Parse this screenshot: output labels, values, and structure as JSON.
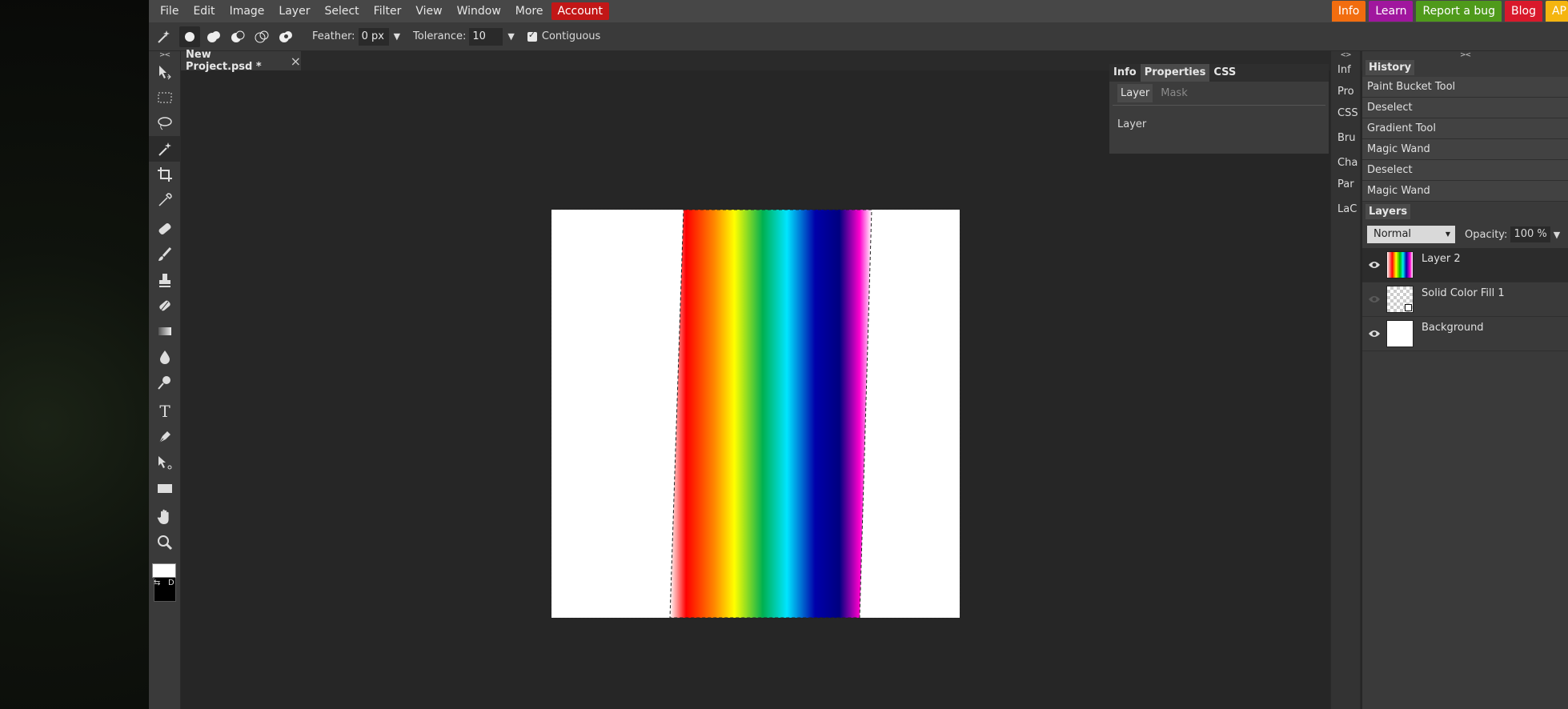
{
  "menu": {
    "items": [
      "File",
      "Edit",
      "Image",
      "Layer",
      "Select",
      "Filter",
      "View",
      "Window",
      "More"
    ],
    "account": "Account"
  },
  "top_links": [
    {
      "label": "Info",
      "color": "#f26d0f"
    },
    {
      "label": "Learn",
      "color": "#a0169e"
    },
    {
      "label": "Report a bug",
      "color": "#4f9a1b"
    },
    {
      "label": "Blog",
      "color": "#d9192b"
    },
    {
      "label": "AP",
      "color": "#f5b50f"
    }
  ],
  "options": {
    "feather_label": "Feather:",
    "feather_value": "0  px",
    "tolerance_label": "Tolerance:",
    "tolerance_value": "10",
    "contiguous_label": "Contiguous"
  },
  "toolbar": {
    "collapse": "><",
    "tools": [
      "move-icon",
      "marquee-icon",
      "lasso-icon",
      "magic-wand-icon",
      "crop-icon",
      "eyedropper-icon",
      "healing-icon",
      "brush-icon",
      "stamp-icon",
      "eraser-icon",
      "gradient-icon",
      "blur-icon",
      "dodge-icon",
      "type-icon",
      "pen-icon",
      "path-select-icon",
      "shape-icon",
      "hand-icon",
      "zoom-icon"
    ],
    "type_glyph": "T"
  },
  "document": {
    "tab_title": "New Project.psd *",
    "close": "×"
  },
  "properties_panel": {
    "tabs": [
      "Info",
      "Properties",
      "CSS"
    ],
    "subtabs": [
      "Layer",
      "Mask"
    ],
    "body": "Layer"
  },
  "side_column": {
    "collapse": "<>",
    "items": [
      "Inf",
      "Pro",
      "CSS",
      "Bru",
      "Cha",
      "Par",
      "LaC"
    ]
  },
  "right_panel": {
    "collapse": "><",
    "history_title": "History",
    "history": [
      "Paint Bucket Tool",
      "Deselect",
      "Gradient Tool",
      "Magic Wand",
      "Deselect",
      "Magic Wand"
    ],
    "layers_title": "Layers",
    "blend_mode": "Normal",
    "opacity_label": "Opacity:",
    "opacity_value": "100 %",
    "layers": [
      {
        "name": "Layer 2",
        "visible": true,
        "active": true
      },
      {
        "name": "Solid Color Fill 1",
        "visible": false,
        "active": false
      },
      {
        "name": "Background",
        "visible": true,
        "active": false
      }
    ]
  },
  "swatches": {
    "foreground": "#ffffff",
    "background": "#000000",
    "swap": "⇆",
    "default": "D"
  }
}
